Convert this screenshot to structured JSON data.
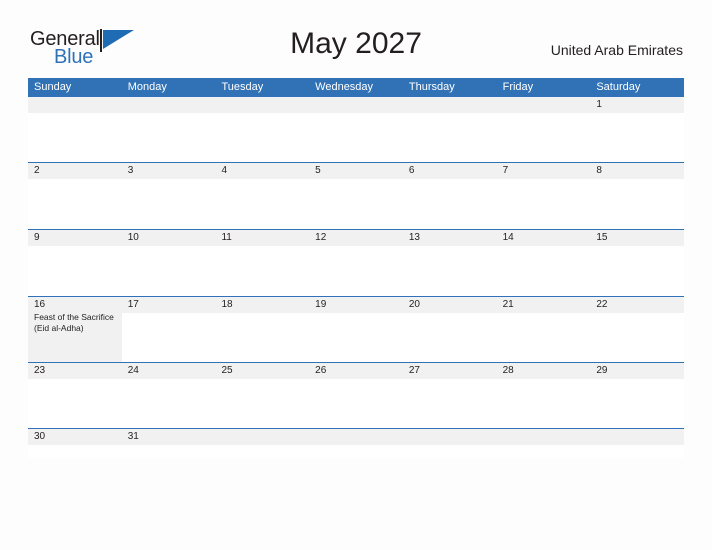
{
  "brand": {
    "name_part1": "General",
    "name_part2": "Blue",
    "flag_icon": "flag-triangle-icon"
  },
  "header": {
    "title": "May 2027",
    "country": "United Arab Emirates"
  },
  "calendar": {
    "month": "May",
    "year": "2027",
    "day_headers": [
      "Sunday",
      "Monday",
      "Tuesday",
      "Wednesday",
      "Thursday",
      "Friday",
      "Saturday"
    ],
    "colors": {
      "header_blue": "#3072b5",
      "divider_blue": "#2f72b8",
      "band_gray": "#f1f1f1",
      "brand_blue": "#2f72b8",
      "text": "#231f20",
      "page_background": "#fdfdfd"
    },
    "weeks": [
      [
        {
          "num": "",
          "event": ""
        },
        {
          "num": "",
          "event": ""
        },
        {
          "num": "",
          "event": ""
        },
        {
          "num": "",
          "event": ""
        },
        {
          "num": "",
          "event": ""
        },
        {
          "num": "",
          "event": ""
        },
        {
          "num": "1",
          "event": ""
        }
      ],
      [
        {
          "num": "2",
          "event": ""
        },
        {
          "num": "3",
          "event": ""
        },
        {
          "num": "4",
          "event": ""
        },
        {
          "num": "5",
          "event": ""
        },
        {
          "num": "6",
          "event": ""
        },
        {
          "num": "7",
          "event": ""
        },
        {
          "num": "8",
          "event": ""
        }
      ],
      [
        {
          "num": "9",
          "event": ""
        },
        {
          "num": "10",
          "event": ""
        },
        {
          "num": "11",
          "event": ""
        },
        {
          "num": "12",
          "event": ""
        },
        {
          "num": "13",
          "event": ""
        },
        {
          "num": "14",
          "event": ""
        },
        {
          "num": "15",
          "event": ""
        }
      ],
      [
        {
          "num": "16",
          "event": "Feast of the Sacrifice (Eid al-Adha)"
        },
        {
          "num": "17",
          "event": ""
        },
        {
          "num": "18",
          "event": ""
        },
        {
          "num": "19",
          "event": ""
        },
        {
          "num": "20",
          "event": ""
        },
        {
          "num": "21",
          "event": ""
        },
        {
          "num": "22",
          "event": ""
        }
      ],
      [
        {
          "num": "23",
          "event": ""
        },
        {
          "num": "24",
          "event": ""
        },
        {
          "num": "25",
          "event": ""
        },
        {
          "num": "26",
          "event": ""
        },
        {
          "num": "27",
          "event": ""
        },
        {
          "num": "28",
          "event": ""
        },
        {
          "num": "29",
          "event": ""
        }
      ],
      [
        {
          "num": "30",
          "event": ""
        },
        {
          "num": "31",
          "event": ""
        },
        {
          "num": "",
          "event": ""
        },
        {
          "num": "",
          "event": ""
        },
        {
          "num": "",
          "event": ""
        },
        {
          "num": "",
          "event": ""
        },
        {
          "num": "",
          "event": ""
        }
      ]
    ]
  }
}
